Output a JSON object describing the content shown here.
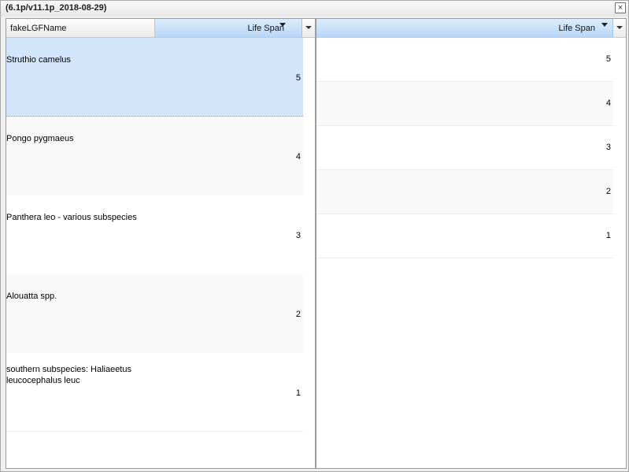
{
  "window": {
    "title": "(6.1p/v11.1p_2018-08-29)",
    "close_label": "×"
  },
  "left_grid": {
    "columns": [
      "fakeLGFName",
      "Life Span"
    ],
    "rows": [
      {
        "name": "Struthio camelus",
        "life_span": "5"
      },
      {
        "name": "Pongo pygmaeus",
        "life_span": "4"
      },
      {
        "name": "Panthera leo - various subspecies",
        "life_span": "3"
      },
      {
        "name": "Alouatta spp.",
        "life_span": "2"
      },
      {
        "name": "southern subspecies: Haliaeetus leucocephalus leuc",
        "life_span": "1"
      }
    ]
  },
  "right_grid": {
    "columns": [
      "Life Span"
    ],
    "rows": [
      "5",
      "4",
      "3",
      "2",
      "1"
    ]
  }
}
